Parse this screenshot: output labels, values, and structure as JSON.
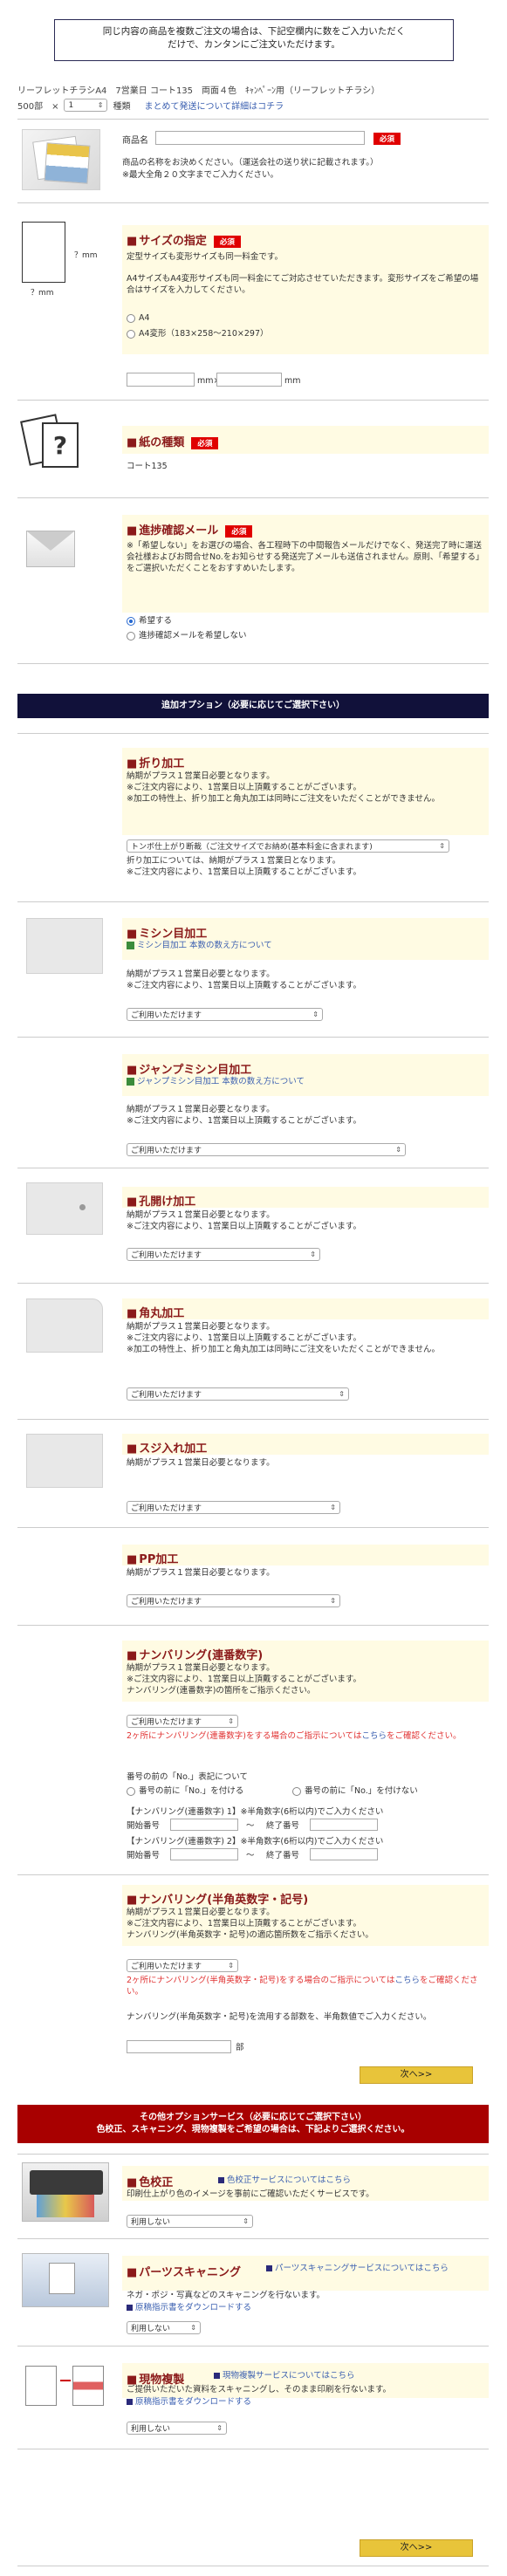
{
  "notice": {
    "line1": "同じ内容の商品を複数ご注文の場合は、下記空欄内に数をご入力いただく",
    "line2": "だけで、カンタンにご注文いただけます。"
  },
  "product": {
    "name": "リーフレットチラシA4　7営業日 コート135　両面４色　ｷｬﾝﾍﾟｰﾝ用（リーフレットチラシ）",
    "qty_label": "500部　×",
    "count": "1",
    "kinds": "種類",
    "ship_link": "まとめて発送について詳細はコチラ"
  },
  "product_name": {
    "label": "商品名",
    "req": "必須",
    "note1": "商品の名称をお決めください。（運送会社の送り状に記載されます。）",
    "note2": "※最大全角２０文字までご入力ください。"
  },
  "size": {
    "title": "サイズの指定",
    "req": "必須",
    "diag_v": "？mm",
    "diag_h": "？mm",
    "desc1": "定型サイズも変形サイズも同一料金です。",
    "desc2": "A4サイズもA4変形サイズも同一料金にてご対応させていただきます。変形サイズをご希望の場合はサイズを入力してください。",
    "opt1": "A4",
    "opt2": "A4変形（183×258〜210×297）",
    "unit1": "mm×",
    "unit2": "mm"
  },
  "paper": {
    "title": "紙の種類",
    "req": "必須",
    "value": "コート135"
  },
  "progress": {
    "title": "進捗確認メール",
    "req": "必須",
    "desc": "※「希望しない」をお選びの場合、各工程時下の中間報告メールだけでなく、発送完了時に運送会社様およびお問合せNo.をお知らせする発送完了メールも送信されません。原則、「希望する」をご選択いただくことをおすすめいたします。",
    "opt1": "希望する",
    "opt2": "進捗確認メールを希望しない"
  },
  "options_bar": "追加オプション（必要に応じてご選択下さい）",
  "fold": {
    "title": "折り加工",
    "l1": "納期がプラス１営業日必要となります。",
    "l2": "※ご注文内容により、1営業日以上頂戴することがございます。",
    "l3": "※加工の特性上、折り加工と角丸加工は同時にご注文をいただくことができません。",
    "select": "トンボ仕上がり断裁（ご注文サイズでお納め(基本料金に含まれます)",
    "l4": "折り加工については、納期がプラス１営業日となります。",
    "l5": "※ご注文内容により、1営業日以上頂戴することがございます。"
  },
  "perf": {
    "title": "ミシン目加工",
    "link": "ミシン目加工 本数の数え方について",
    "l1": "納期がプラス１営業日必要となります。",
    "l2": "※ご注文内容により、1営業日以上頂戴することがございます。",
    "select": "ご利用いただけます"
  },
  "jump": {
    "title": "ジャンプミシン目加工",
    "link": "ジャンプミシン目加工 本数の数え方について",
    "l1": "納期がプラス１営業日必要となります。",
    "l2": "※ご注文内容により、1営業日以上頂戴することがございます。",
    "select": "ご利用いただけます"
  },
  "hole": {
    "title": "孔開け加工",
    "l1": "納期がプラス１営業日必要となります。",
    "l2": "※ご注文内容により、1営業日以上頂戴することがございます。",
    "select": "ご利用いただけます"
  },
  "corner": {
    "title": "角丸加工",
    "l1": "納期がプラス１営業日必要となります。",
    "l2": "※ご注文内容により、1営業日以上頂戴することがございます。",
    "l3": "※加工の特性上、折り加工と角丸加工は同時にご注文をいただくことができません。",
    "select": "ご利用いただけます"
  },
  "crease": {
    "title": "スジ入れ加工",
    "l1": "納期がプラス１営業日必要となります。",
    "select": "ご利用いただけます"
  },
  "pp": {
    "title": "PP加工",
    "l1": "納期がプラス１営業日必要となります。",
    "select": "ご利用いただけます"
  },
  "numbering": {
    "title": "ナンバリング(連番数字)",
    "l1": "納期がプラス１営業日必要となります。",
    "l2": "※ご注文内容により、1営業日以上頂戴することがございます。",
    "l3": "ナンバリング(連番数字)の箇所をご指示ください。",
    "select": "ご利用いただけます",
    "warn": "2ヶ所にナンバリング(連番数字)をする場合のご指示については",
    "warn_link": "こちら",
    "warn_end": "をご確認ください。",
    "prefix_q": "番号の前の「No.」表記について",
    "r1": "番号の前に「No.」を付ける",
    "r2": "番号の前に「No.」を付けない",
    "n1": "【ナンバリング(連番数字) 1】※半角数字(6桁以内)でご入力ください",
    "start": "開始番号",
    "tilde": "〜",
    "end": "終了番号",
    "n2": "【ナンバリング(連番数字) 2】※半角数字(6桁以内)でご入力ください"
  },
  "alnum": {
    "title": "ナンバリング(半角英数字・記号)",
    "l1": "納期がプラス１営業日必要となります。",
    "l2": "※ご注文内容により、1営業日以上頂戴することがございます。",
    "l3": "ナンバリング(半角英数字・記号)の適応箇所数をご指示ください。",
    "select": "ご利用いただけます",
    "warn": "2ヶ所にナンバリング(半角英数字・記号)をする場合のご指示については",
    "warn_link": "こちら",
    "warn_end": "をご確認ください。",
    "l4": "ナンバリング(半角英数字・記号)を流用する部数を、半角数値でご入力ください。",
    "unit": "部",
    "next": "次へ>>"
  },
  "services_bar": {
    "line1": "その他オプションサービス（必要に応じてご選択下さい）",
    "line2": "色校正、スキャニング、現物複製をご希望の場合は、下記よりご選択ください。"
  },
  "proof": {
    "title": "色校正",
    "link": "色校正サービスについてはこちら",
    "desc": "印刷仕上がり色のイメージを事前にご確認いただくサービスです。",
    "select": "利用しない"
  },
  "scan": {
    "title": "パーツスキャニング",
    "link": "パーツスキャニングサービスについてはこちら",
    "desc": "ネガ・ポジ・写真などのスキャニングを行ないます。",
    "dl": "原稿指示書をダウンロードする",
    "select": "利用しない"
  },
  "copy": {
    "title": "現物複製",
    "link": "現物複製サービスについてはこちら",
    "desc": "ご提供いただいた資料をスキャニングし、そのまま印刷を行ないます。",
    "dl": "原稿指示書をダウンロードする",
    "select": "利用しない"
  },
  "final_next": "次へ>>"
}
